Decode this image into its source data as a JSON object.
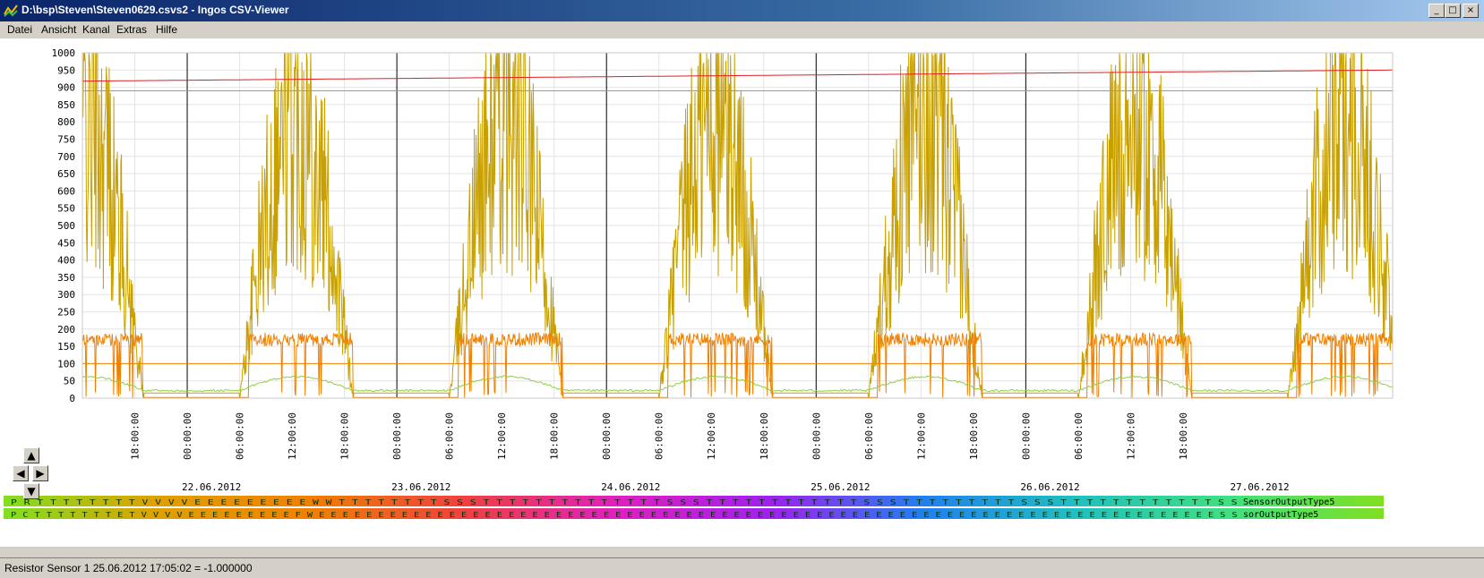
{
  "window": {
    "title": "D:\\bsp\\Steven\\Steven0629.csvs2 - Ingos CSV-Viewer",
    "controls": [
      "_",
      "□",
      "×"
    ]
  },
  "menu": [
    {
      "label": "Datei"
    },
    {
      "label": "Ansicht"
    },
    {
      "label": "Kanal"
    },
    {
      "label": "Extras"
    },
    {
      "label": "Hilfe"
    }
  ],
  "chart_data": {
    "type": "line",
    "y_range": [
      0,
      1000
    ],
    "y_ticks": [
      "1000",
      "950",
      "900",
      "850",
      "800",
      "750",
      "700",
      "650",
      "600",
      "550",
      "500",
      "450",
      "400",
      "350",
      "300",
      "250",
      "200",
      "150",
      "100",
      "50",
      "0"
    ],
    "time_ticks": [
      "18:00:00",
      "00:00:00",
      "06:00:00",
      "12:00:00",
      "18:00:00",
      "00:00:00",
      "06:00:00",
      "12:00:00",
      "18:00:00",
      "00:00:00",
      "06:00:00",
      "12:00:00",
      "18:00:00",
      "00:00:00",
      "06:00:00",
      "12:00:00",
      "18:00:00",
      "00:00:00",
      "06:00:00",
      "12:00:00",
      "18:00:00"
    ],
    "date_labels": [
      "22.06.2012",
      "23.06.2012",
      "24.06.2012",
      "25.06.2012",
      "26.06.2012",
      "27.06.2012"
    ],
    "x_start": "2012-06-22 12:00:00",
    "x_end": "2012-06-28 18:00:00",
    "hour_step": 6,
    "colors": {
      "gold": "#c8a000",
      "orange": "#f08000",
      "red": "#e02020",
      "green": "#90d040",
      "grid": "#e4e4e4",
      "day": "#000000"
    },
    "reference_lines": [
      {
        "value": 1000,
        "color": "#c8a000"
      },
      {
        "value": 890,
        "color": "#c8a000"
      },
      {
        "value": 100,
        "color": "#f08000"
      }
    ],
    "series": [
      {
        "color": "#c8a000"
      },
      {
        "color": "#f08000"
      },
      {
        "color": "#e02020"
      },
      {
        "color": "#90d040"
      }
    ]
  },
  "channel_bands": [
    {
      "label": "SensorOutputType5",
      "letters": "P R T T T T T T T T V V V V E E E E E E E E E W W T T T T T T T T S S S T T T T T T T T T T T T T T S S S T T T T T T T T T T T T S S S T T T T T T T T T S S S T T T T T T T T T T T T S S"
    },
    {
      "label": "sorOutputType5",
      "letters": "P C T T T T T T T E T V V V V E E E E E E E E E F W E E E E E E E E E E E E E E E E E E E E E E E E E E E E E E E E E E E E E E E E E E E E E E E E E E E E E E E E E E E E E E E E E E E E E E E E E E E E S S"
    }
  ],
  "status": "Resistor Sensor 1 25.06.2012 17:05:02 = -1.000000"
}
